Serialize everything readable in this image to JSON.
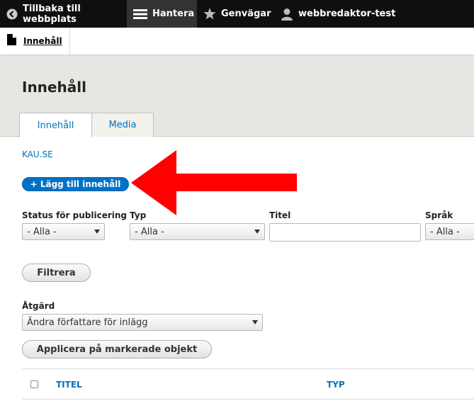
{
  "toolbar": {
    "back_label": "Tillbaka till webbplats",
    "manage_label": "Hantera",
    "shortcuts_label": "Genvägar",
    "user_label": "webbredaktor-test"
  },
  "tray": {
    "content_label": "Innehåll"
  },
  "header": {
    "title": "Innehåll",
    "tabs": [
      {
        "label": "Innehåll",
        "active": true
      },
      {
        "label": "Media",
        "active": false
      }
    ]
  },
  "main": {
    "site_link": "KAU.SE",
    "add_button": "+ Lägg till innehåll",
    "filters": {
      "status_label": "Status för publicering",
      "status_value": "- Alla -",
      "type_label": "Typ",
      "type_value": "- Alla -",
      "title_label": "Titel",
      "title_value": "",
      "language_label": "Språk",
      "language_value": "- Alla -"
    },
    "filter_button": "Filtrera",
    "action_label": "Åtgärd",
    "action_value": "Ändra författare för inlägg",
    "apply_button": "Applicera på markerade objekt",
    "table_headers": [
      "TITEL",
      "TYP"
    ]
  },
  "colors": {
    "accent": "#0074bd",
    "arrow": "#ff0000"
  }
}
